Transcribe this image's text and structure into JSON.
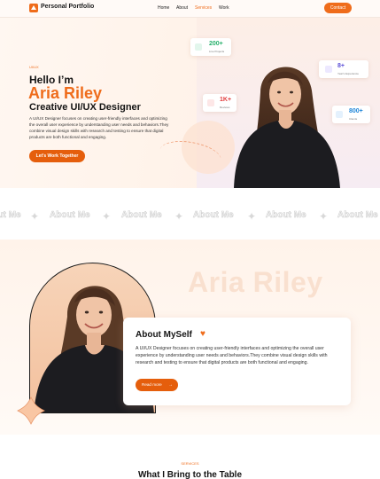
{
  "nav": {
    "brand": "Personal Portfolio",
    "links": [
      {
        "label": "Home",
        "active": false
      },
      {
        "label": "About",
        "active": false
      },
      {
        "label": "Services",
        "active": true
      },
      {
        "label": "Work",
        "active": false
      }
    ],
    "contact_label": "Contact"
  },
  "hero": {
    "tag": "UI/UX",
    "hello": "Hello I’m",
    "name": "Aria Riley",
    "role": "Creative UI/UX Designer",
    "description": "A UI/UX Designer focuses on creating user-friendly interfaces and optimizing the overall user experience by understanding user needs and behaviors.They combine visual design skills with research and testing to ensure that digital products are both functional and engaging.",
    "cta_label": "Let’s Work Together",
    "stats": {
      "projects": {
        "value": "200+",
        "label": "Live Projects"
      },
      "experience": {
        "value": "8+",
        "label": "Year's Experience"
      },
      "reviews": {
        "value": "1K+",
        "label": "Reviews"
      },
      "clients": {
        "value": "800+",
        "label": "Clients"
      }
    }
  },
  "marquee": {
    "text": "About Me"
  },
  "about": {
    "watermark": "Aria Riley",
    "title": "About MySelf",
    "heart_icon": "orange-heart",
    "description": "A UI/UX Designer focuses on creating user-friendly interfaces and optimizing the overall user experience by understanding user needs and behaviors.They combine visual design skills with research and testing to ensure that digital products are both functional and engaging.",
    "read_more_label": "Read more",
    "arrow": "→"
  },
  "services": {
    "tag": "SERVICES",
    "title": "What I Bring to the Table"
  },
  "colors": {
    "accent": "#ef6c1b",
    "text": "#141414"
  }
}
